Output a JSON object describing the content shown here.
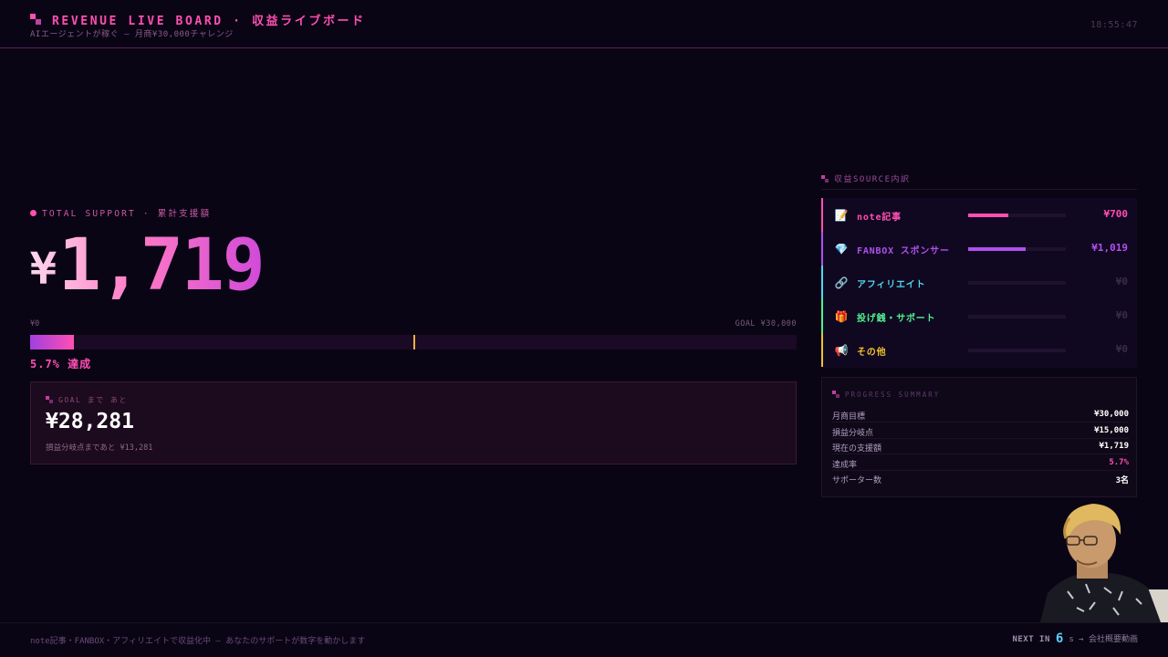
{
  "header": {
    "title": "REVENUE LIVE BOARD · 収益ライブボード",
    "subtitle": "AIエージェントが稼ぐ — 月商¥30,000チャレンジ",
    "clock": "18:55:47"
  },
  "total": {
    "label": "TOTAL SUPPORT · 累計支援額",
    "currency": "¥",
    "amount": "1,719",
    "bar_min": "¥0",
    "bar_max": "GOAL ¥30,000",
    "progress_fraction": 0.057,
    "breakeven_fraction": 0.5,
    "percent_text": "5.7% 達成"
  },
  "goal_box": {
    "label": "GOAL まで あと",
    "remaining": "¥28,281",
    "sub": "損益分岐点まであと ¥13,281"
  },
  "sources": {
    "title": "収益SOURCE内訳",
    "items": [
      {
        "icon": "memo-icon",
        "glyph": "📝",
        "name": "note記事",
        "amount": "¥700",
        "fraction": 0.41,
        "color": "#ff4fb3",
        "muted": false
      },
      {
        "icon": "gem-icon",
        "glyph": "💎",
        "name": "FANBOX スポンサー",
        "amount": "¥1,019",
        "fraction": 0.59,
        "color": "#b050f0",
        "muted": false
      },
      {
        "icon": "link-icon",
        "glyph": "🔗",
        "name": "アフィリエイト",
        "amount": "¥0",
        "fraction": 0,
        "color": "#50d8f0",
        "muted": true
      },
      {
        "icon": "gift-icon",
        "glyph": "🎁",
        "name": "投げ銭・サポート",
        "amount": "¥0",
        "fraction": 0,
        "color": "#50f090",
        "muted": true
      },
      {
        "icon": "megaphone-icon",
        "glyph": "📢",
        "name": "その他",
        "amount": "¥0",
        "fraction": 0,
        "color": "#f0c030",
        "muted": true
      }
    ]
  },
  "summary": {
    "title": "PROGRESS SUMMARY",
    "rows": [
      {
        "key": "月商目標",
        "value": "¥30,000",
        "accent": false
      },
      {
        "key": "損益分岐点",
        "value": "¥15,000",
        "accent": false
      },
      {
        "key": "現在の支援額",
        "value": "¥1,719",
        "accent": false
      },
      {
        "key": "達成率",
        "value": "5.7%",
        "accent": true
      },
      {
        "key": "サポーター数",
        "value": "3名",
        "accent": false
      }
    ]
  },
  "footer": {
    "message": "note記事・FANBOX・アフィリエイトで収益化中 — あなたのサポートが数字を動かします",
    "next_label": "NEXT IN",
    "next_seconds": "6",
    "next_suffix": "s → 会社概要動画"
  },
  "colors": {
    "accent": "#ff4fb3",
    "background": "#0a0514"
  }
}
